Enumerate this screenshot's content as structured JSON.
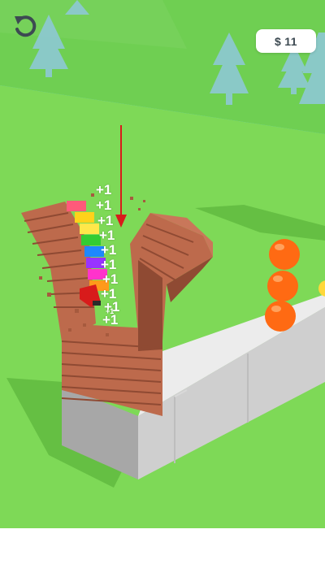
{
  "hud": {
    "restart_icon": "restart-arrow-icon",
    "currency_symbol": "$",
    "money": "11"
  },
  "score_popups": [
    "+1",
    "+1",
    "+1",
    "+1",
    "+1",
    "+1",
    "+1",
    "+1",
    "+1",
    "+1",
    "+1"
  ],
  "colors": {
    "sky": "#63c9ef",
    "grass": "#7ed957",
    "grass_dark": "#5fb83f",
    "wood": "#bd6a4c",
    "wood_dark": "#8f4a33",
    "platform": "#ececec",
    "platform_side": "#b9b9b9",
    "orange": "#ff6a13",
    "arrow": "#d81b1b",
    "tree": "#8fc8dc"
  },
  "rainbow_blocks": [
    "#ff5a7a",
    "#ffd21a",
    "#ffe74a",
    "#33cc33",
    "#1e88ff",
    "#9933ff",
    "#ff33cc",
    "#ff9a1a"
  ]
}
